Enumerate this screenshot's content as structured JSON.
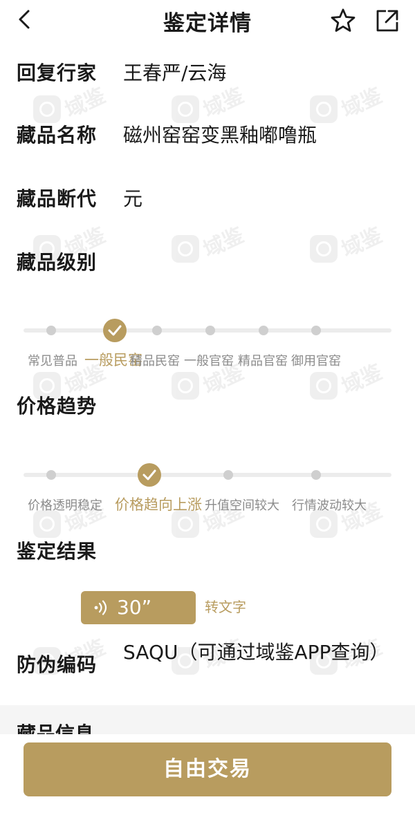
{
  "header": {
    "title": "鉴定详情",
    "back_icon": "chevron-left-icon",
    "favorite_icon": "star-icon",
    "share_icon": "share-icon"
  },
  "watermark": {
    "text": "域鉴"
  },
  "details": {
    "expert": {
      "label": "回复行家",
      "value": "王春严/云海"
    },
    "name": {
      "label": "藏品名称",
      "value": "磁州窑窑变黑釉嘟噜瓶"
    },
    "era": {
      "label": "藏品断代",
      "value": "元"
    },
    "grade_label": "藏品级别",
    "trend_label": "价格趋势",
    "result_label": "鉴定结果",
    "code": {
      "label": "防伪编码",
      "value": "SAQU",
      "note": "（可通过域鉴APP查询）"
    },
    "info_label": "藏品信息"
  },
  "grade": {
    "selected_index": 1,
    "steps": [
      "常见普品",
      "一般民窑",
      "精品民窑",
      "一般官窑",
      "精品官窑",
      "御用官窑"
    ]
  },
  "trend": {
    "selected_index": 1,
    "steps": [
      "价格透明稳定",
      "价格趋向上涨",
      "升值空间较大",
      "行情波动较大"
    ]
  },
  "audio": {
    "duration": "30”",
    "to_text_label": "转文字"
  },
  "footer": {
    "trade_label": "自由交易"
  },
  "colors": {
    "accent": "#b89c5f",
    "dot": "#cfcfcf",
    "track": "#ececec",
    "muted_text": "#8b8b8b"
  }
}
